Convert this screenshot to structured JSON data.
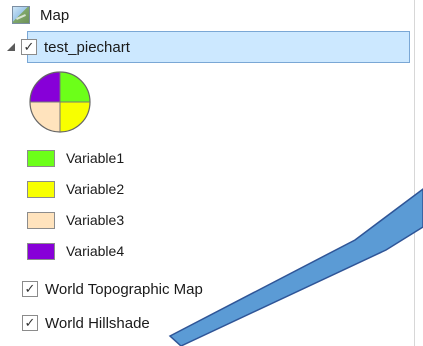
{
  "contents_panel": {
    "map": {
      "label": "Map",
      "icon": "map-icon"
    },
    "active_layer": {
      "label": "test_piechart",
      "checked": true,
      "expanded": true,
      "symbol": {
        "type": "pie-symbol",
        "colors": [
          "#8700d8",
          "#6cff19",
          "#f8ff00",
          "#ffe3bd"
        ]
      },
      "legend": [
        {
          "label": "Variable1",
          "color": "#6cff19"
        },
        {
          "label": "Variable2",
          "color": "#f8ff00"
        },
        {
          "label": "Variable3",
          "color": "#ffe3bd"
        },
        {
          "label": "Variable4",
          "color": "#8700d8"
        }
      ]
    },
    "basemap_layers": [
      {
        "label": "World Topographic Map",
        "checked": true
      },
      {
        "label": "World Hillshade",
        "checked": true
      }
    ]
  },
  "annotation": {
    "color": "#5b9bd5",
    "outline": "#2f5597"
  }
}
